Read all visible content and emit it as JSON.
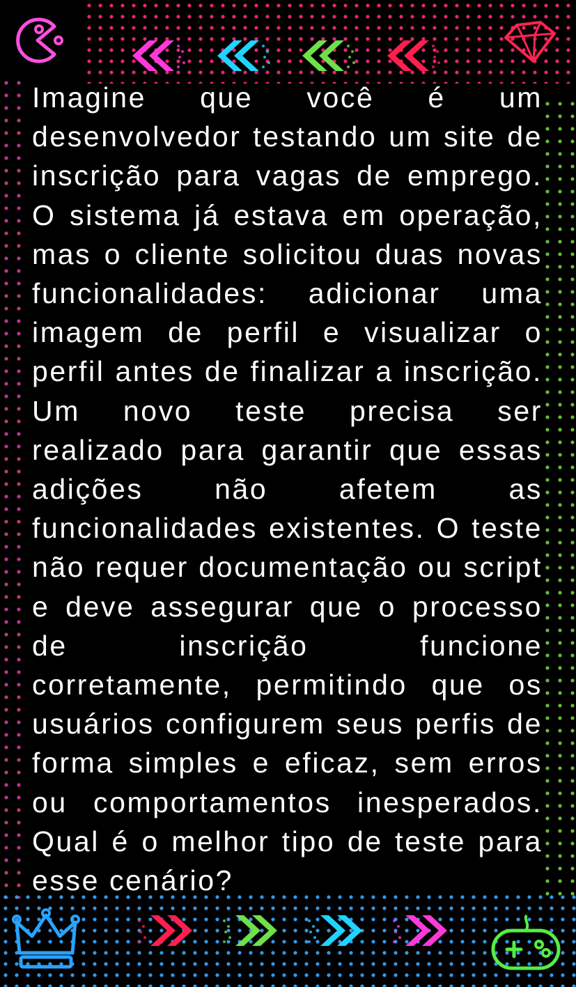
{
  "question": {
    "text": "Imagine que você é um desenvolvedor testando um site de inscrição para vagas de emprego. O sistema já estava em operação, mas o cliente solicitou duas novas funcionalidades: adicionar uma imagem de perfil e visualizar o perfil antes de finalizar a inscrição. Um novo teste precisa ser realizado para garantir que essas adições não afetem as funcionalidades existentes. O teste não requer documentação ou script e deve assegurar que o processo de inscrição funcione corretamente, permitindo que os usuários configurem seus perfis de forma simples e eficaz, sem erros ou comportamentos inesperados. Qual é o melhor tipo de teste para esse cenário?"
  },
  "decorations": {
    "top_left": "pacman-icon",
    "top_right": "diamond-icon",
    "bottom_left": "crown-icon",
    "bottom_right": "gamepad-icon",
    "top_chevrons": [
      "chevron-left-pink",
      "chevron-left-cyan",
      "chevron-left-green",
      "chevron-left-red"
    ],
    "bottom_chevrons": [
      "chevron-right-red",
      "chevron-right-green",
      "chevron-right-cyan",
      "chevron-right-pink"
    ]
  },
  "colors": {
    "background": "#000000",
    "text": "#ffffff",
    "pink": "#ff3ad8",
    "cyan": "#22d3ff",
    "green": "#6ee04a",
    "red": "#ff1f4f",
    "blue": "#2aa3ff"
  }
}
